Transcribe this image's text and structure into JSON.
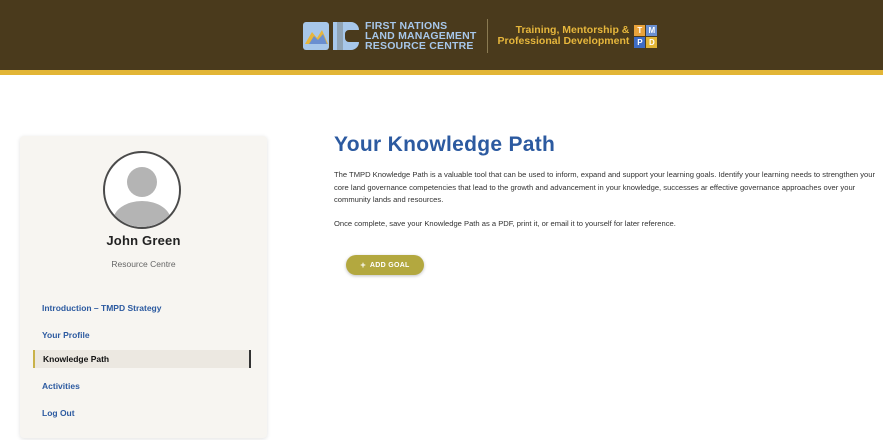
{
  "header": {
    "org_lines": [
      "FIRST NATIONS",
      "LAND MANAGEMENT",
      "RESOURCE CENTRE"
    ],
    "program_lines": [
      "Training, Mentorship &",
      "Professional Development"
    ],
    "tmpd_letters": [
      "T",
      "M",
      "P",
      "D"
    ],
    "colors": {
      "bar": "#4a3a1c",
      "stripe": "#e2b536",
      "org_text": "#a7c7ea",
      "program_text": "#e6b63c",
      "tmpd": [
        "#e9a23a",
        "#6a8fd0",
        "#3e6cc4",
        "#e2b536"
      ]
    },
    "logo_icon": "rc-logo-icon"
  },
  "sidebar": {
    "user_name": "John Green",
    "user_org": "Resource Centre",
    "nav": [
      {
        "label": "Introduction – TMPD Strategy",
        "active": false
      },
      {
        "label": "Your Profile",
        "active": false
      },
      {
        "label": "Knowledge Path",
        "active": true
      },
      {
        "label": "Activities",
        "active": false
      },
      {
        "label": "Log Out",
        "active": false
      }
    ]
  },
  "main": {
    "title": "Your Knowledge Path",
    "intro": "The TMPD Knowledge Path is a valuable tool that can be used to inform, expand and support your learning goals. Identify your learning needs to strengthen your core land governance competencies that lead to the growth and advancement in your knowledge, successes ar effective governance approaches over your community lands and resources.",
    "intro2": "Once complete, save your Knowledge Path as a PDF, print it, or email it to yourself for later reference.",
    "add_goal_label": "ADD GOAL",
    "add_goal_icon": "plus-icon"
  }
}
